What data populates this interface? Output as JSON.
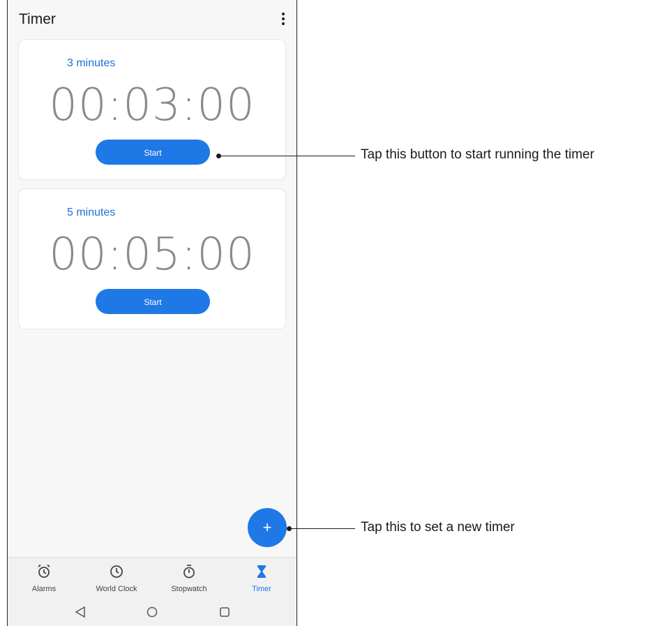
{
  "header": {
    "title": "Timer",
    "menu_icon": "more-vert-icon"
  },
  "timers": [
    {
      "name": "3 minutes",
      "time": "00:03:00",
      "start_label": "Start"
    },
    {
      "name": "5 minutes",
      "time": "00:05:00",
      "start_label": "Start"
    }
  ],
  "fab": {
    "label": "+",
    "icon": "plus-icon"
  },
  "tabs": [
    {
      "label": "Alarms",
      "icon": "alarm-icon"
    },
    {
      "label": "World Clock",
      "icon": "clock-icon"
    },
    {
      "label": "Stopwatch",
      "icon": "stopwatch-icon"
    },
    {
      "label": "Timer",
      "icon": "hourglass-icon",
      "active": true
    }
  ],
  "navbar": [
    "back-icon",
    "home-icon",
    "recents-icon"
  ],
  "callouts": {
    "start": "Tap this button to start running the timer",
    "fab": "Tap this to set a new timer"
  },
  "colors": {
    "accent": "#1e78e6",
    "label_blue": "#1e6fd9"
  }
}
